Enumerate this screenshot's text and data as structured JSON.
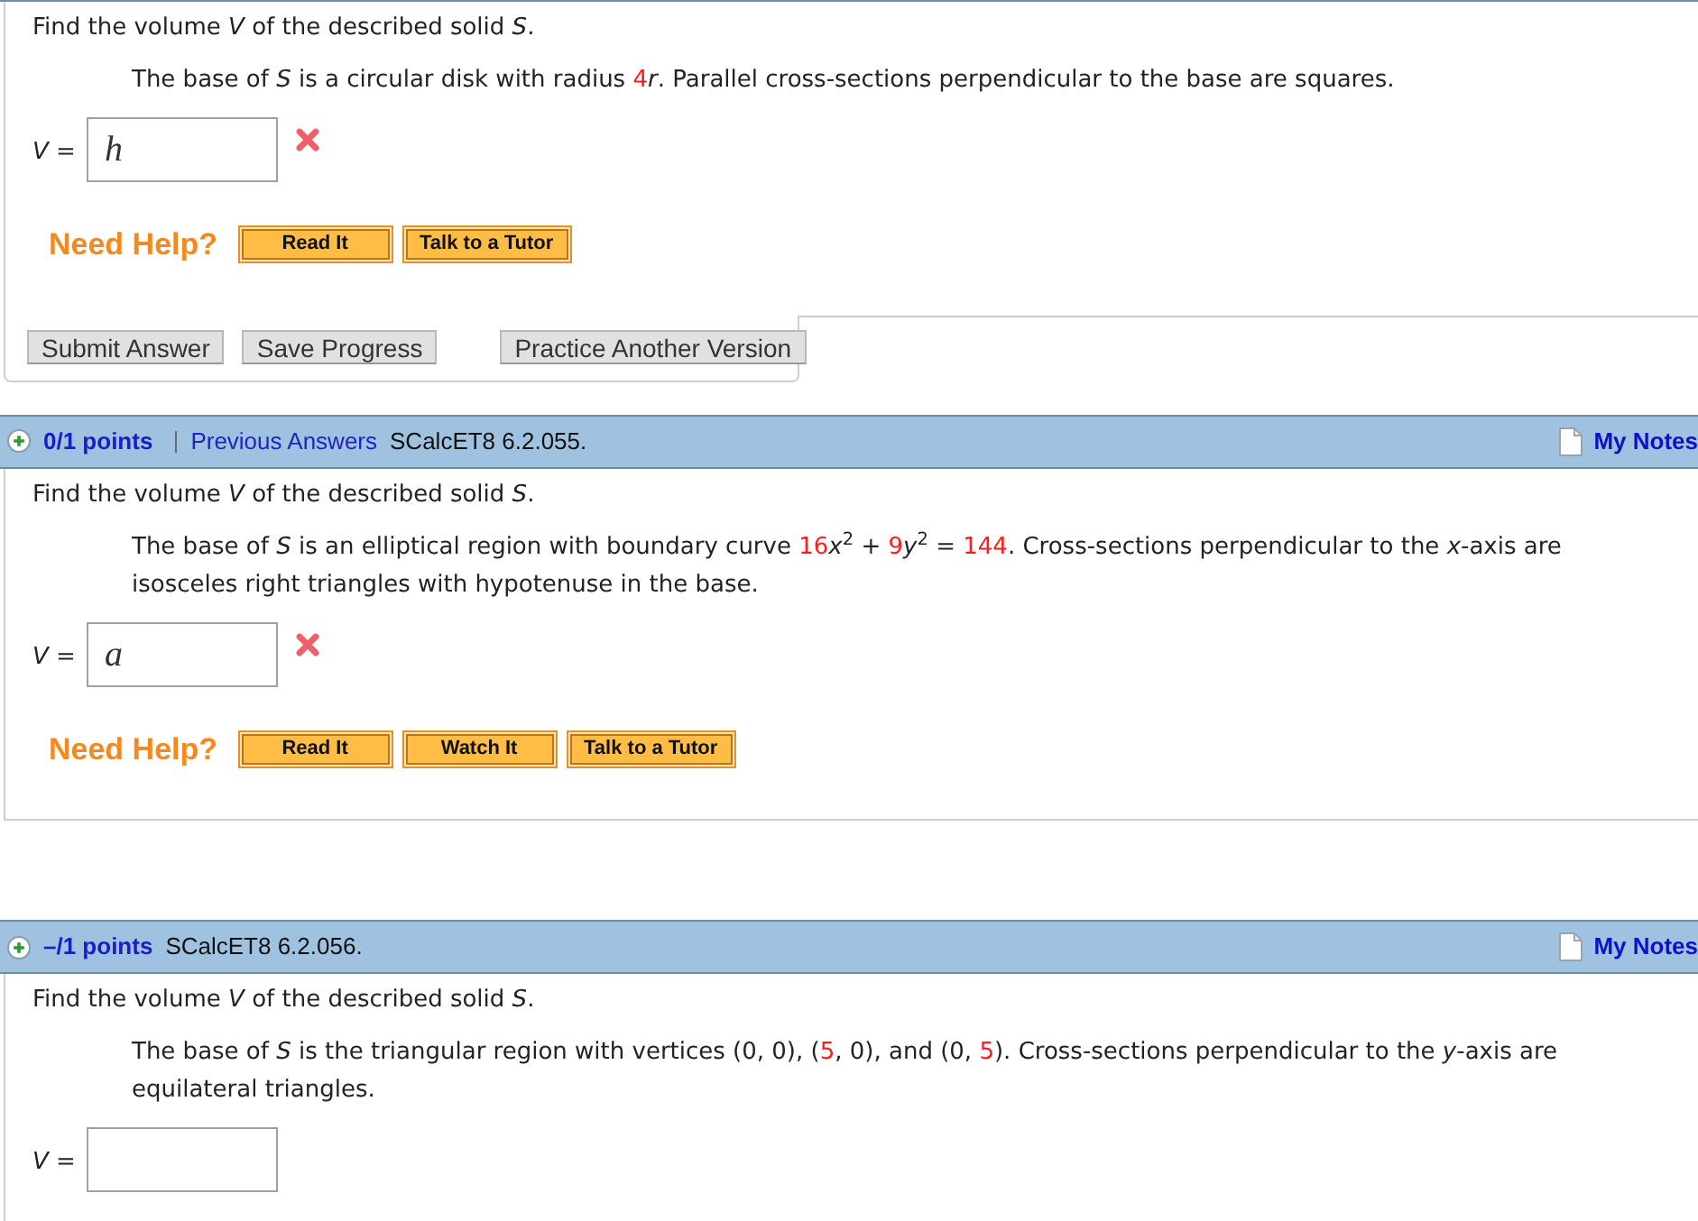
{
  "questions": [
    {
      "instruction": "Find the volume *V* of the described solid *S*.",
      "statement": [
        {
          "kind": "text",
          "text": "The base of *S* is a circular disk with radius "
        },
        {
          "kind": "random",
          "text": "4"
        },
        {
          "kind": "text",
          "text": "*r*. Parallel cross-sections perpendicular to the base are squares."
        }
      ],
      "answer": {
        "label": "*V* =",
        "value": "h",
        "correct": false
      },
      "help": {
        "title": "Need Help?",
        "buttons": [
          "Read It",
          "Talk to a Tutor"
        ]
      },
      "actions": {
        "buttons": [
          "Submit Answer",
          "Save Progress"
        ],
        "alternate": "Practice Another Version"
      }
    },
    {
      "header": {
        "points": "0/1 points",
        "previous_answers": "Previous Answers",
        "code": "SCalcET8 6.2.055.",
        "notes": "My Notes"
      },
      "instruction": "Find the volume *V* of the described solid *S*.",
      "statement": [
        {
          "kind": "text",
          "text": "The base of *S* is an elliptical region with boundary curve "
        },
        {
          "kind": "random",
          "text": "16"
        },
        {
          "kind": "text",
          "text": "*x*$^{2}$ + "
        },
        {
          "kind": "random",
          "text": "9"
        },
        {
          "kind": "text",
          "text": "*y*$^{2}$ = "
        },
        {
          "kind": "random",
          "text": "144"
        },
        {
          "kind": "text",
          "text": ". Cross-sections perpendicular to the *x*-axis are isosceles right triangles with hypotenuse in the base."
        }
      ],
      "answer": {
        "label": "*V* =",
        "value": "a",
        "correct": false
      },
      "help": {
        "title": "Need Help?",
        "buttons": [
          "Read It",
          "Watch It",
          "Talk to a Tutor"
        ]
      }
    },
    {
      "header": {
        "points": "–/1 points",
        "code": "SCalcET8 6.2.056.",
        "notes": "My Notes"
      },
      "instruction": "Find the volume *V* of the described solid *S*.",
      "statement": [
        {
          "kind": "text",
          "text": "The base of *S* is the triangular region with vertices (0, 0), ("
        },
        {
          "kind": "random",
          "text": "5"
        },
        {
          "kind": "text",
          "text": ", 0), and (0, "
        },
        {
          "kind": "random",
          "text": "5"
        },
        {
          "kind": "text",
          "text": "). Cross-sections perpendicular to the *y*-axis are equilateral triangles."
        }
      ],
      "answer": {
        "label": "*V* ="
      }
    }
  ]
}
